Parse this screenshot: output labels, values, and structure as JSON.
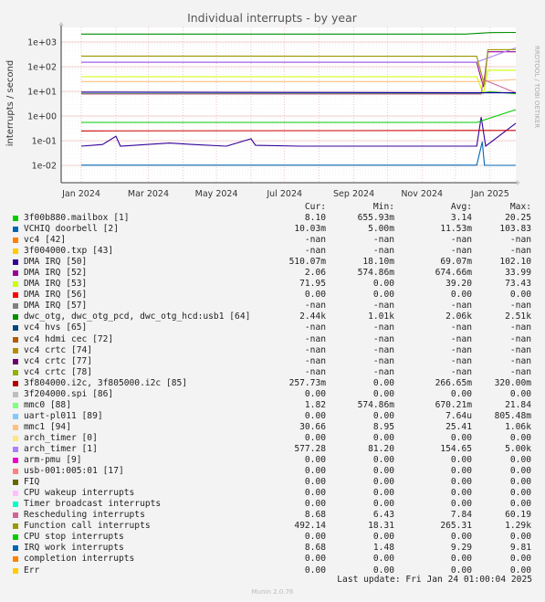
{
  "chart_data": {
    "type": "line",
    "title": "Individual interrupts - by year",
    "ylabel": "interrupts / second",
    "side_label": "RRDTOOL / TOBI OETIKER",
    "yscale": "log",
    "ylim": [
      0.005,
      2500
    ],
    "y_ticks": [
      "1e-02",
      "1e-01",
      "1e+00",
      "1e+01",
      "1e+02",
      "1e+03"
    ],
    "x_ticks": [
      "Jan 2024",
      "Mar 2024",
      "May 2024",
      "Jul 2024",
      "Sep 2024",
      "Nov 2024",
      "Jan 2025"
    ],
    "grid": true,
    "series": [
      {
        "name": "3f00b880.mailbox [1]",
        "color": "#00cc00",
        "points": [
          [
            "2024-01-01",
            8.1
          ],
          [
            "2024-12-20",
            8.1
          ],
          [
            "2025-01-01",
            9.5
          ],
          [
            "2025-01-24",
            8.1
          ]
        ]
      },
      {
        "name": "VCHIQ doorbell [2]",
        "color": "#0066b3",
        "points": [
          [
            "2024-01-01",
            0.0102
          ],
          [
            "2024-12-20",
            0.0102
          ],
          [
            "2024-12-25",
            0.09
          ],
          [
            "2024-12-27",
            0.01
          ],
          [
            "2025-01-24",
            0.01
          ]
        ]
      },
      {
        "name": "DMA IRQ [50]",
        "color": "#330099",
        "points": [
          [
            "2024-01-01",
            0.06
          ],
          [
            "2024-01-20",
            0.07
          ],
          [
            "2024-02-01",
            0.15
          ],
          [
            "2024-02-05",
            0.06
          ],
          [
            "2024-03-20",
            0.08
          ],
          [
            "2024-04-10",
            0.07
          ],
          [
            "2024-05-10",
            0.06
          ],
          [
            "2024-06-01",
            0.12
          ],
          [
            "2024-06-05",
            0.065
          ],
          [
            "2024-07-15",
            0.06
          ],
          [
            "2024-10-01",
            0.06
          ],
          [
            "2024-12-20",
            0.06
          ],
          [
            "2024-12-24",
            0.9
          ],
          [
            "2024-12-28",
            0.06
          ],
          [
            "2025-01-24",
            0.51
          ]
        ]
      },
      {
        "name": "DMA IRQ [52]",
        "color": "#990099",
        "points": [
          [
            "2024-01-01",
            150
          ],
          [
            "2024-12-20",
            150
          ],
          [
            "2024-12-26",
            15
          ],
          [
            "2024-12-30",
            400
          ],
          [
            "2025-01-24",
            400
          ]
        ]
      },
      {
        "name": "DMA IRQ [53]",
        "color": "#ccff00",
        "points": [
          [
            "2024-01-01",
            39
          ],
          [
            "2024-12-20",
            39
          ],
          [
            "2024-12-26",
            8
          ],
          [
            "2024-12-30",
            72
          ],
          [
            "2025-01-24",
            72
          ]
        ]
      },
      {
        "name": "dwc_otg, dwc_otg_pcd, dwc_otg_hcd:usb1 [64]",
        "color": "#008f00",
        "points": [
          [
            "2024-01-01",
            2100
          ],
          [
            "2024-12-10",
            2100
          ],
          [
            "2025-01-01",
            2400
          ],
          [
            "2025-01-24",
            2440
          ]
        ]
      },
      {
        "name": "3f804000.i2c, 3f805000.i2c [85]",
        "color": "#cc0000",
        "points": [
          [
            "2024-01-01",
            0.25
          ],
          [
            "2025-01-24",
            0.26
          ]
        ]
      },
      {
        "name": "mmc0 [88]",
        "color": "#00cc00",
        "points": [
          [
            "2024-01-01",
            0.55
          ],
          [
            "2024-12-20",
            0.55
          ],
          [
            "2025-01-24",
            1.82
          ]
        ]
      },
      {
        "name": "mmc1 [94]",
        "color": "#ffc080",
        "points": [
          [
            "2024-01-01",
            25
          ],
          [
            "2024-12-20",
            25
          ],
          [
            "2025-01-24",
            30
          ]
        ]
      },
      {
        "name": "arch_timer [1]",
        "color": "#aa88ff",
        "points": [
          [
            "2024-01-01",
            155
          ],
          [
            "2024-12-20",
            155
          ],
          [
            "2025-01-24",
            577
          ]
        ]
      },
      {
        "name": "Rescheduling interrupts",
        "color": "#cc6699",
        "points": [
          [
            "2024-01-01",
            7.8
          ],
          [
            "2024-12-24",
            7.8
          ],
          [
            "2024-12-26",
            30
          ],
          [
            "2025-01-24",
            8.7
          ]
        ]
      },
      {
        "name": "Function call interrupts",
        "color": "#999900",
        "points": [
          [
            "2024-01-01",
            270
          ],
          [
            "2024-12-20",
            265
          ],
          [
            "2024-12-27",
            18
          ],
          [
            "2024-12-30",
            490
          ],
          [
            "2025-01-24",
            492
          ]
        ]
      },
      {
        "name": "IRQ work interrupts",
        "color": "#0000aa",
        "points": [
          [
            "2024-01-01",
            9.3
          ],
          [
            "2025-01-24",
            8.7
          ]
        ]
      }
    ]
  },
  "legend_header": {
    "cur": "Cur:",
    "min": "Min:",
    "avg": "Avg:",
    "max": "Max:"
  },
  "legend": [
    {
      "name": "3f00b880.mailbox [1]",
      "color": "#00cc00",
      "cur": "8.10",
      "min": "655.93m",
      "avg": "3.14",
      "max": "20.25"
    },
    {
      "name": "VCHIQ doorbell [2]",
      "color": "#0066b3",
      "cur": "10.03m",
      "min": "5.00m",
      "avg": "11.53m",
      "max": "103.83"
    },
    {
      "name": "vc4 [42]",
      "color": "#ff8000",
      "cur": "-nan",
      "min": "-nan",
      "avg": "-nan",
      "max": "-nan"
    },
    {
      "name": "3f004000.txp [43]",
      "color": "#ffcc00",
      "cur": "-nan",
      "min": "-nan",
      "avg": "-nan",
      "max": "-nan"
    },
    {
      "name": "DMA IRQ [50]",
      "color": "#330099",
      "cur": "510.07m",
      "min": "18.10m",
      "avg": "69.07m",
      "max": "102.10"
    },
    {
      "name": "DMA IRQ [52]",
      "color": "#990099",
      "cur": "2.06",
      "min": "574.86m",
      "avg": "674.66m",
      "max": "33.99"
    },
    {
      "name": "DMA IRQ [53]",
      "color": "#ccff00",
      "cur": "71.95",
      "min": "0.00",
      "avg": "39.20",
      "max": "73.43"
    },
    {
      "name": "DMA IRQ [56]",
      "color": "#ff0000",
      "cur": "0.00",
      "min": "0.00",
      "avg": "0.00",
      "max": "0.00"
    },
    {
      "name": "DMA IRQ [57]",
      "color": "#808080",
      "cur": "-nan",
      "min": "-nan",
      "avg": "-nan",
      "max": "-nan"
    },
    {
      "name": "dwc_otg, dwc_otg_pcd, dwc_otg_hcd:usb1 [64]",
      "color": "#008f00",
      "cur": "2.44k",
      "min": "1.01k",
      "avg": "2.06k",
      "max": "2.51k"
    },
    {
      "name": "vc4 hvs [65]",
      "color": "#00487d",
      "cur": "-nan",
      "min": "-nan",
      "avg": "-nan",
      "max": "-nan"
    },
    {
      "name": "vc4 hdmi cec [72]",
      "color": "#b35a00",
      "cur": "-nan",
      "min": "-nan",
      "avg": "-nan",
      "max": "-nan"
    },
    {
      "name": "vc4 crtc [74]",
      "color": "#b38f00",
      "cur": "-nan",
      "min": "-nan",
      "avg": "-nan",
      "max": "-nan"
    },
    {
      "name": "vc4 crtc [77]",
      "color": "#6b006b",
      "cur": "-nan",
      "min": "-nan",
      "avg": "-nan",
      "max": "-nan"
    },
    {
      "name": "vc4 crtc [78]",
      "color": "#8fb300",
      "cur": "-nan",
      "min": "-nan",
      "avg": "-nan",
      "max": "-nan"
    },
    {
      "name": "3f804000.i2c, 3f805000.i2c [85]",
      "color": "#b30000",
      "cur": "257.73m",
      "min": "0.00",
      "avg": "266.65m",
      "max": "320.00m"
    },
    {
      "name": "3f204000.spi [86]",
      "color": "#bebebe",
      "cur": "0.00",
      "min": "0.00",
      "avg": "0.00",
      "max": "0.00"
    },
    {
      "name": "mmc0 [88]",
      "color": "#80ff80",
      "cur": "1.82",
      "min": "574.86m",
      "avg": "670.21m",
      "max": "21.84"
    },
    {
      "name": "uart-pl011 [89]",
      "color": "#80c9ff",
      "cur": "0.00",
      "min": "0.00",
      "avg": "7.64u",
      "max": "805.48m"
    },
    {
      "name": "mmc1 [94]",
      "color": "#ffc080",
      "cur": "30.66",
      "min": "8.95",
      "avg": "25.41",
      "max": "1.06k"
    },
    {
      "name": "arch_timer [0]",
      "color": "#ffe680",
      "cur": "0.00",
      "min": "0.00",
      "avg": "0.00",
      "max": "0.00"
    },
    {
      "name": "arch_timer [1]",
      "color": "#aa80ff",
      "cur": "577.28",
      "min": "81.20",
      "avg": "154.65",
      "max": "5.00k"
    },
    {
      "name": "arm-pmu [9]",
      "color": "#ee00cc",
      "cur": "0.00",
      "min": "0.00",
      "avg": "0.00",
      "max": "0.00"
    },
    {
      "name": "usb-001:005:01 [17]",
      "color": "#ff8080",
      "cur": "0.00",
      "min": "0.00",
      "avg": "0.00",
      "max": "0.00"
    },
    {
      "name": "FIQ",
      "color": "#666600",
      "cur": "0.00",
      "min": "0.00",
      "avg": "0.00",
      "max": "0.00"
    },
    {
      "name": "CPU wakeup interrupts",
      "color": "#ffbfff",
      "cur": "0.00",
      "min": "0.00",
      "avg": "0.00",
      "max": "0.00"
    },
    {
      "name": "Timer broadcast interrupts",
      "color": "#00ffcc",
      "cur": "0.00",
      "min": "0.00",
      "avg": "0.00",
      "max": "0.00"
    },
    {
      "name": "Rescheduling interrupts",
      "color": "#cc6699",
      "cur": "8.68",
      "min": "6.43",
      "avg": "7.84",
      "max": "60.19"
    },
    {
      "name": "Function call interrupts",
      "color": "#999900",
      "cur": "492.14",
      "min": "18.31",
      "avg": "265.31",
      "max": "1.29k"
    },
    {
      "name": "CPU stop interrupts",
      "color": "#00cc00",
      "cur": "0.00",
      "min": "0.00",
      "avg": "0.00",
      "max": "0.00"
    },
    {
      "name": "IRQ work interrupts",
      "color": "#0066b3",
      "cur": "8.68",
      "min": "1.48",
      "avg": "9.29",
      "max": "9.81"
    },
    {
      "name": "completion interrupts",
      "color": "#ff8000",
      "cur": "0.00",
      "min": "0.00",
      "avg": "0.00",
      "max": "0.00"
    },
    {
      "name": "Err",
      "color": "#ffcc00",
      "cur": "0.00",
      "min": "0.00",
      "avg": "0.00",
      "max": "0.00"
    }
  ],
  "last_update": "Last update: Fri Jan 24 01:00:04 2025",
  "footer": "Munin 2.0.76"
}
